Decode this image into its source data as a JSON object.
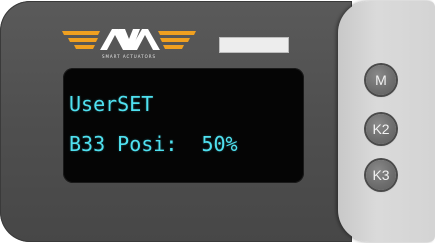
{
  "brand": {
    "logo_text": "AVA",
    "tagline": "SMART ACTUATORS",
    "colors": {
      "stripes": "#f0a020",
      "letters": "#ffffff"
    }
  },
  "screen": {
    "line1": "UserSET",
    "line2": "B33 Posi:  50%",
    "text_color": "#4fe1f0"
  },
  "buttons": {
    "m": "M",
    "k2": "K2",
    "k3": "K3"
  }
}
